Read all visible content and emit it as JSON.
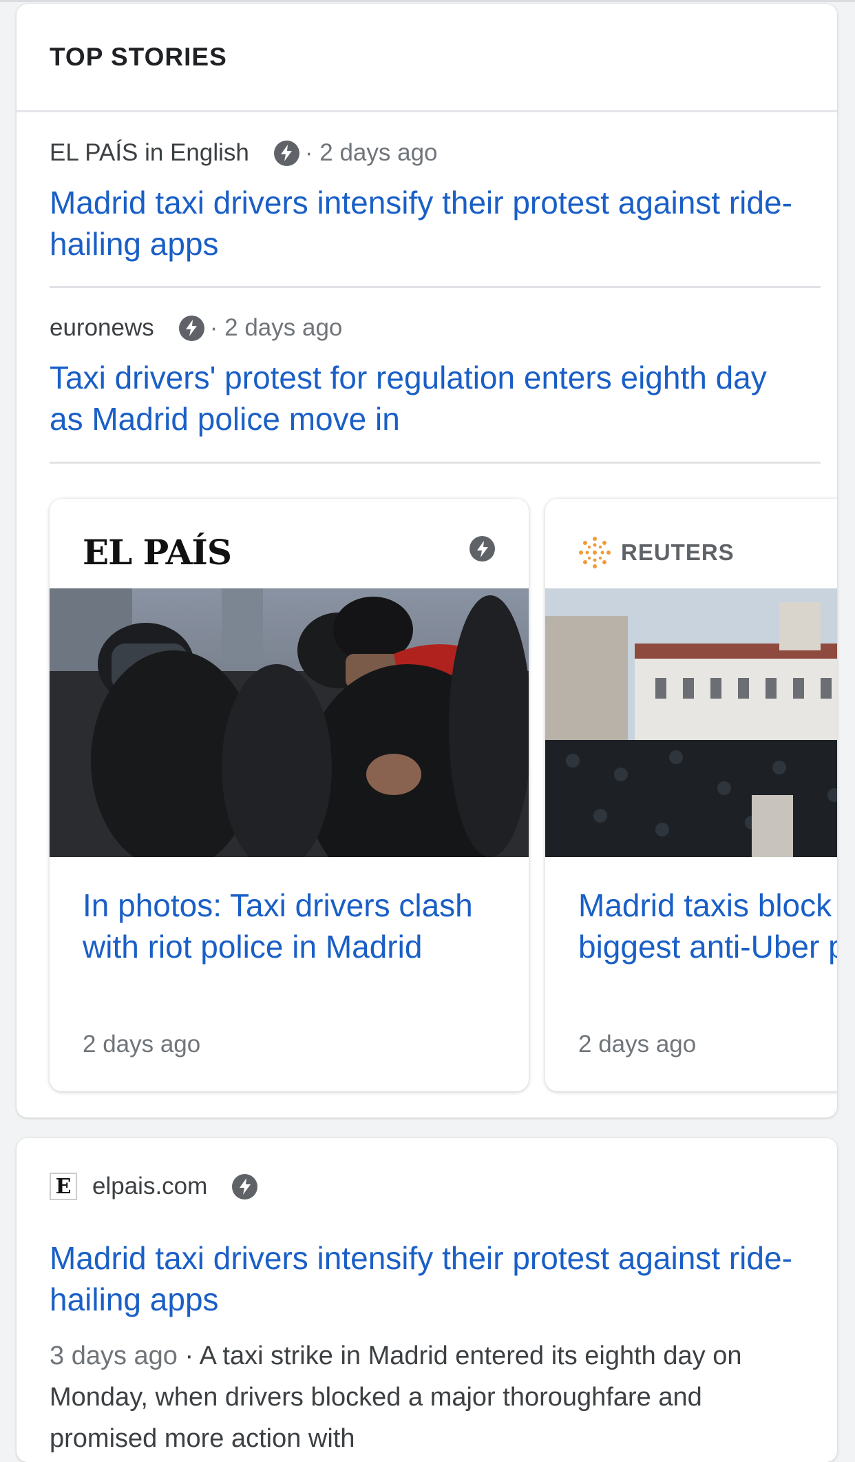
{
  "top_stories": {
    "header": "TOP STORIES",
    "list": [
      {
        "source": "EL PAÍS in English",
        "time": "· 2 days ago",
        "headline": "Madrid taxi drivers intensify their protest against ride-hailing apps"
      },
      {
        "source": "euronews",
        "time": "· 2 days ago",
        "headline": "Taxi drivers' protest for regulation enters eighth day as Madrid police move in"
      }
    ],
    "carousel": [
      {
        "publisher": "EL PAÍS",
        "headline": "In photos: Taxi drivers clash with riot police in Madrid",
        "time": "2 days ago"
      },
      {
        "publisher": "REUTERS",
        "headline": "Madrid taxis block road in biggest anti-Uber protest yet",
        "time": "2 days ago"
      }
    ]
  },
  "result": {
    "favicon": "E",
    "domain": "elpais.com",
    "headline": "Madrid taxi drivers intensify their protest against ride-hailing apps",
    "date": "3 days ago",
    "snippet": " · A taxi strike in Madrid entered its eighth day on Monday, when drivers blocked a major thoroughfare and promised more action with"
  },
  "icons": {
    "amp": "amp-lightning-icon",
    "reuters": "reuters-logo-icon"
  },
  "colors": {
    "link": "#1a5fc6",
    "meta": "#70757a",
    "amp_badge": "#5f6368"
  }
}
